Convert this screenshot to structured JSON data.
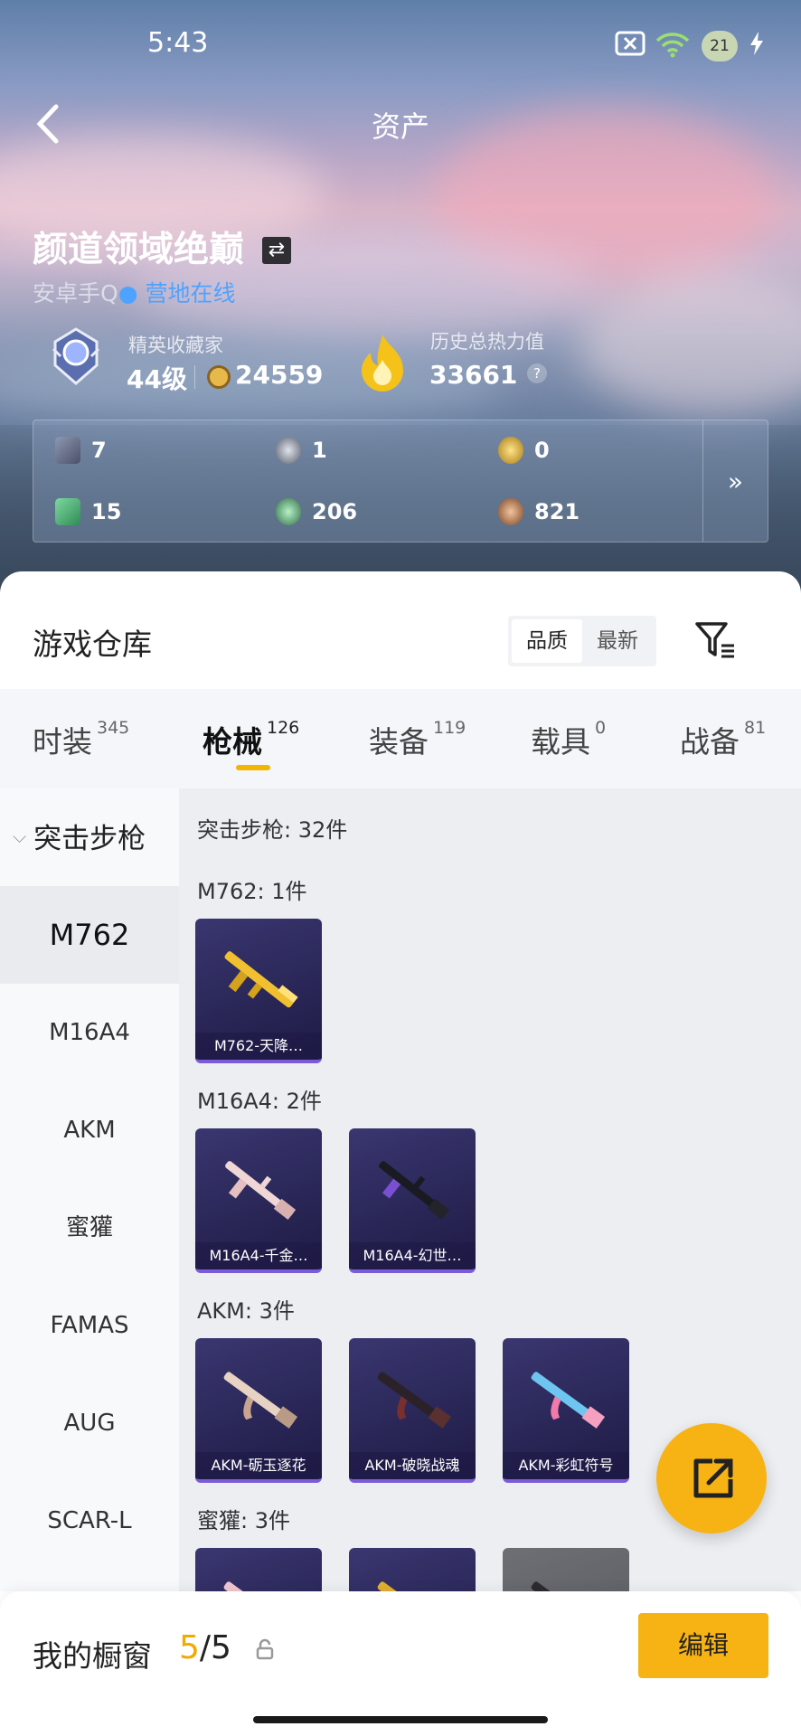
{
  "status": {
    "time": "5:43",
    "battery": "21"
  },
  "nav": {
    "title": "资产"
  },
  "profile": {
    "name": "颜道领域绝巅",
    "platform": "安卓手Q",
    "online": "营地在线",
    "rank_title": "精英收藏家",
    "level": "44级",
    "coins": "24559",
    "heat_label": "历史总热力值",
    "heat_value": "33661",
    "heat_help": "?"
  },
  "stats": [
    {
      "icon": "card-icon",
      "value": "7"
    },
    {
      "icon": "silver-medal-icon",
      "value": "1"
    },
    {
      "icon": "gold-token-icon",
      "value": "0"
    },
    {
      "icon": "green-card-icon",
      "value": "15"
    },
    {
      "icon": "green-orb-icon",
      "value": "206"
    },
    {
      "icon": "bronze-orb-icon",
      "value": "821"
    }
  ],
  "stats_more": "»",
  "warehouse": {
    "title": "游戏仓库",
    "sort": [
      "品质",
      "最新"
    ]
  },
  "tabs": [
    {
      "label": "时装",
      "count": "345"
    },
    {
      "label": "枪械",
      "count": "126"
    },
    {
      "label": "装备",
      "count": "119"
    },
    {
      "label": "载具",
      "count": "0"
    },
    {
      "label": "战备",
      "count": "81"
    }
  ],
  "sidebar": {
    "category": "突击步枪",
    "items": [
      "M762",
      "M16A4",
      "AKM",
      "蜜獾",
      "FAMAS",
      "AUG",
      "SCAR-L"
    ]
  },
  "content": {
    "summary": "突击步枪: 32件",
    "groups": [
      {
        "title": "M762: 1件",
        "items": [
          "M762-天降…"
        ]
      },
      {
        "title": "M16A4: 2件",
        "items": [
          "M16A4-千金…",
          "M16A4-幻世…"
        ]
      },
      {
        "title": "AKM: 3件",
        "items": [
          "AKM-砺玉逐花",
          "AKM-破晓战魂",
          "AKM-彩虹符号"
        ]
      },
      {
        "title": "蜜獾: 3件",
        "items": [
          "",
          "",
          ""
        ]
      }
    ]
  },
  "showcase": {
    "label": "我的橱窗",
    "current": "5",
    "total": "/5",
    "edit": "编辑"
  },
  "colors": {
    "accent": "#f7b314",
    "online": "#4da3ff",
    "card": "#2a2758"
  }
}
